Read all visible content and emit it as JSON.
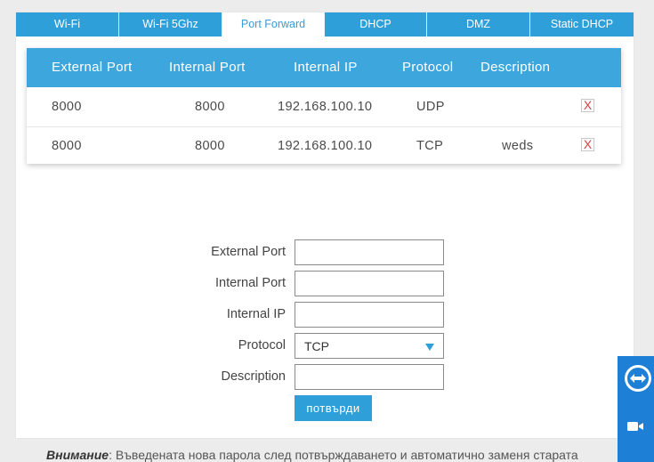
{
  "tabs": [
    {
      "label": "Wi-Fi",
      "active": false
    },
    {
      "label": "Wi-Fi 5Ghz",
      "active": false
    },
    {
      "label": "Port Forward",
      "active": true
    },
    {
      "label": "DHCP",
      "active": false
    },
    {
      "label": "DMZ",
      "active": false
    },
    {
      "label": "Static DHCP",
      "active": false
    }
  ],
  "table": {
    "headers": [
      "External Port",
      "Internal Port",
      "Internal IP",
      "Protocol",
      "Description"
    ],
    "rows": [
      {
        "external_port": "8000",
        "internal_port": "8000",
        "internal_ip": "192.168.100.10",
        "protocol": "UDP",
        "description": "",
        "delete": "X"
      },
      {
        "external_port": "8000",
        "internal_port": "8000",
        "internal_ip": "192.168.100.10",
        "protocol": "TCP",
        "description": "weds",
        "delete": "X"
      }
    ]
  },
  "form": {
    "external_port_label": "External Port",
    "internal_port_label": "Internal Port",
    "internal_ip_label": "Internal IP",
    "protocol_label": "Protocol",
    "protocol_value": "TCP",
    "description_label": "Description",
    "external_port_value": "",
    "internal_port_value": "",
    "internal_ip_value": "",
    "description_value": "",
    "submit_label": "потвърди"
  },
  "note": {
    "bold": "Внимание",
    "text": ": Въведената нова парола след потвърждаването и автоматично заменя старата"
  },
  "colors": {
    "accent": "#2f9fda",
    "header": "#3da6dc",
    "delete": "#e23b3b",
    "teamviewer": "#1e7fd6"
  },
  "icons": {
    "delete": "close-x-icon",
    "dropdown": "triangle-down-icon",
    "teamviewer": "teamviewer-arrows-icon",
    "camera": "video-camera-icon"
  }
}
